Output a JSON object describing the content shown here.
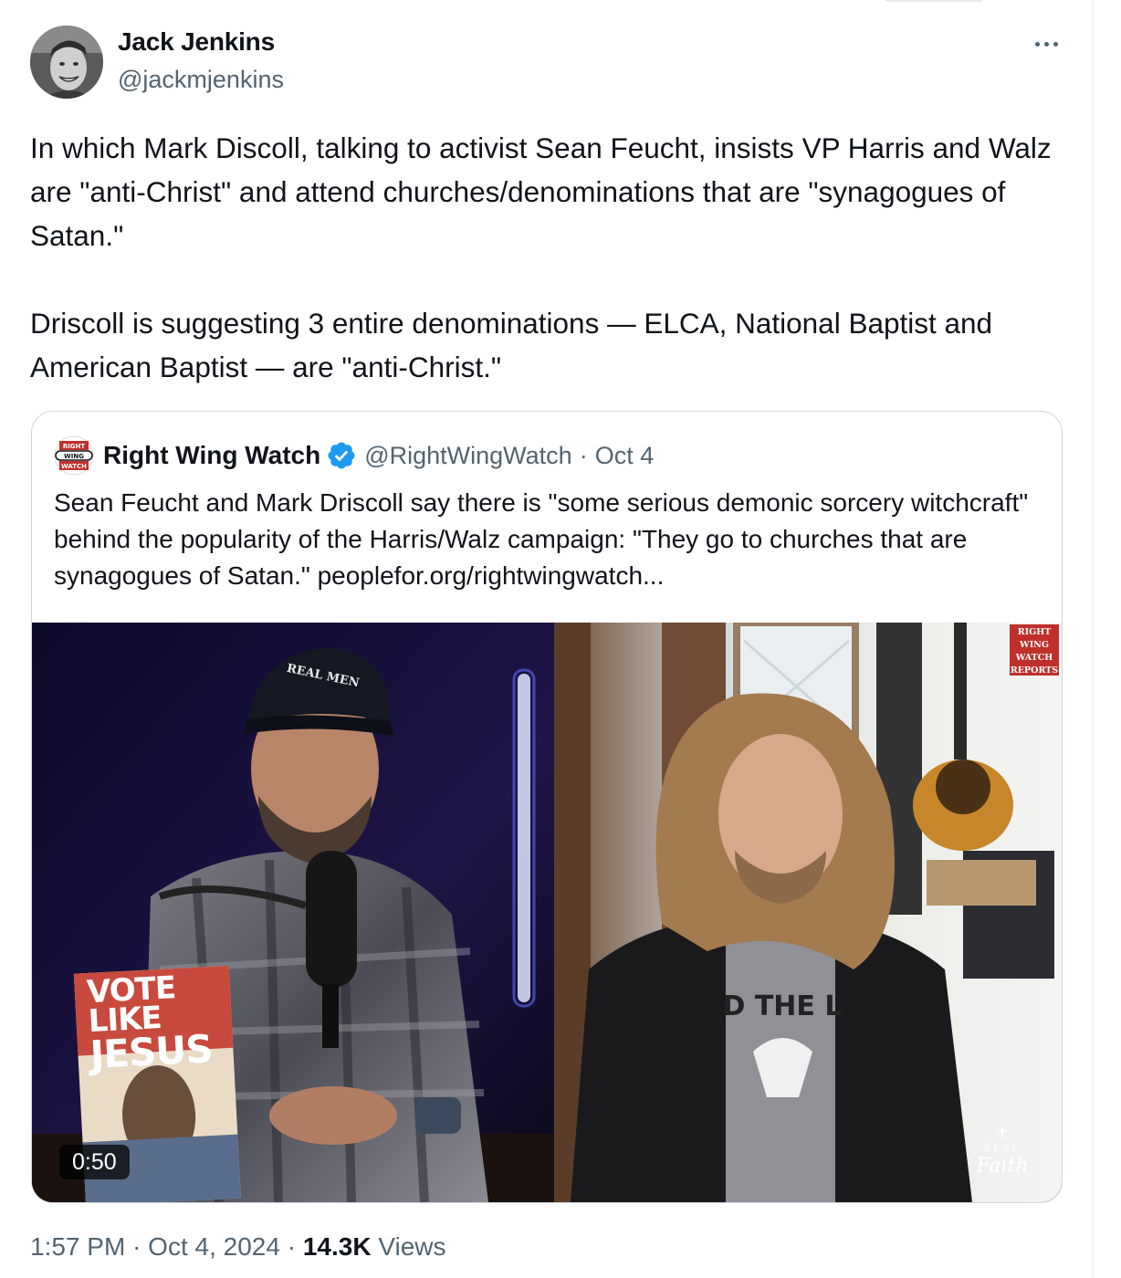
{
  "author": {
    "name": "Jack Jenkins",
    "handle": "@jackmjenkins"
  },
  "tweet": {
    "paragraph1": "In which Mark Discoll, talking to activist Sean Feucht, insists VP Harris and Walz are \"anti-Christ\" and attend churches/denominations that are \"synagogues of Satan.\"",
    "paragraph2": "Driscoll is suggesting 3 entire denominations — ELCA, National Baptist and American Baptist — are \"anti-Christ.\""
  },
  "quote": {
    "name": "Right Wing Watch",
    "handle": "@RightWingWatch",
    "separator": "·",
    "date": "Oct 4",
    "text": "Sean Feucht and Mark Driscoll say there is \"some serious demonic sorcery witchcraft\" behind the popularity of the Harris/Walz campaign: \"They go to churches that are synagogues of Satan.\" peoplefor.org/rightwingwatch...",
    "logo_text": [
      "RIGHT",
      "WING",
      "WATCH"
    ],
    "video": {
      "duration": "0:50",
      "hat_text": "REAL MEN",
      "book_line1": "VOTE LIKE",
      "book_line2": "JESUS",
      "badge_lines": [
        "RIGHT",
        "WING",
        "WATCH",
        "REPORTS"
      ],
      "watermark_real": "REAL",
      "watermark_faith": "Faith",
      "shirt_text": "D THE L"
    }
  },
  "meta": {
    "time": "1:57 PM",
    "sep1": "·",
    "date": "Oct 4, 2024",
    "sep2": "·",
    "views_count": "14.3K",
    "views_label": "Views"
  },
  "colors": {
    "text": "#0f1419",
    "secondary": "#536471",
    "verified": "#1d9bf0",
    "border": "#cfd9de",
    "rww_red": "#c0302b"
  },
  "icons": [
    "more-icon",
    "verified-badge-icon"
  ]
}
